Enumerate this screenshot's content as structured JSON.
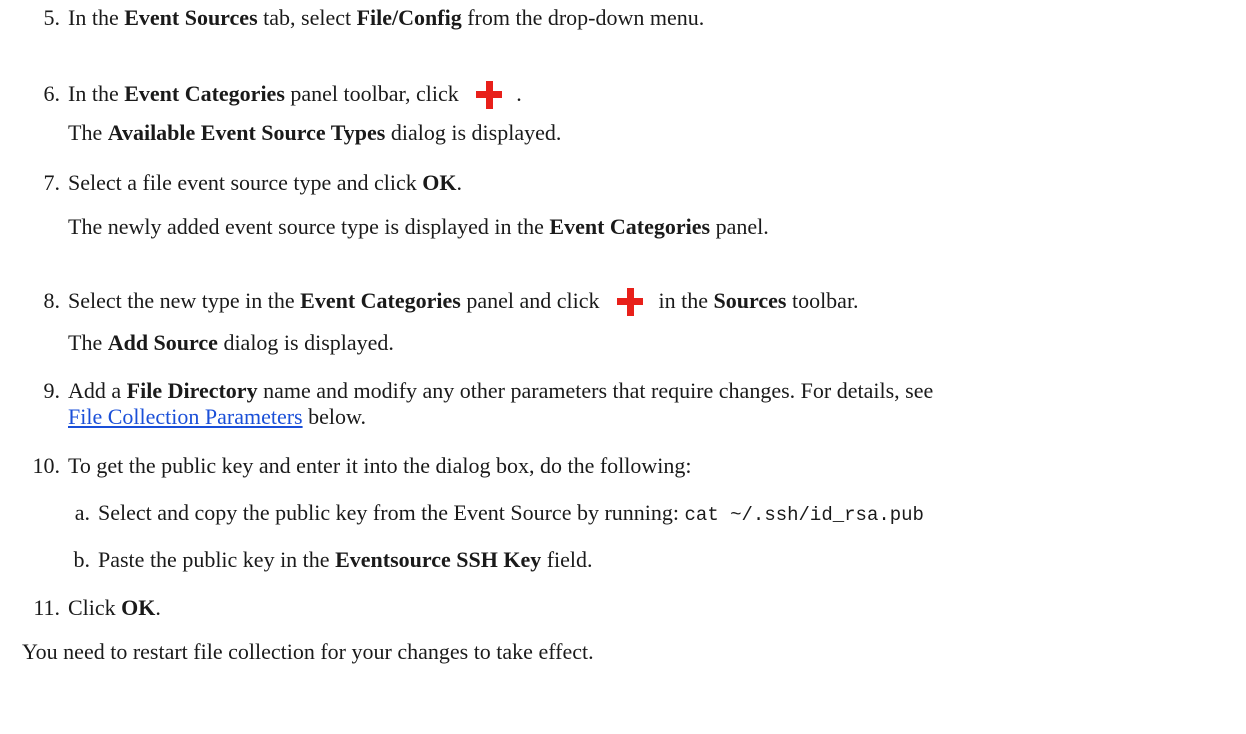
{
  "steps": [
    {
      "number": "5.",
      "text_1": "In the ",
      "bold_1": "Event Sources",
      "text_2": " tab, select ",
      "bold_2": "File/Config",
      "text_3": " from the drop-down menu."
    },
    {
      "number": "6.",
      "text_1": "In the ",
      "bold_1": "Event Categories",
      "text_2": " panel toolbar, click ",
      "icon": "plus-icon",
      "text_3": ".",
      "result_bold": "Available Event Source Types",
      "result_pre": "The ",
      "result_post": " dialog is displayed."
    },
    {
      "number": "7.",
      "text_1": "Select a file event source type and click ",
      "bold_1": "OK",
      "text_2": ".",
      "result_pre": "The newly added event source type is displayed in the ",
      "result_bold": "Event Categories",
      "result_post": " panel."
    },
    {
      "number": "8.",
      "text_1": "Select the new type in the ",
      "bold_1": "Event Categories",
      "text_2": " panel and click ",
      "icon": "plus-icon",
      "text_3": " in the ",
      "bold_2": "Sources",
      "text_4": " toolbar.",
      "result_pre": "The ",
      "result_bold": "Add Source",
      "result_post": " dialog is displayed."
    },
    {
      "number": "9.",
      "text_1": "Add a ",
      "bold_1": "File Directory",
      "text_2": " name and modify any other parameters that require changes. For details, see",
      "link": "File Collection Parameters",
      "text_3": " below."
    },
    {
      "number": "10.",
      "text_1": "To get the public key and enter it into the dialog box, do the following:",
      "substeps": [
        {
          "letter": "a.",
          "text_1": "Select and copy the public key from the Event Source by running: ",
          "code": "cat ~/.ssh/id_rsa.pub"
        },
        {
          "letter": "b.",
          "text_1": "Paste the public key in the ",
          "bold_1": "Eventsource SSH Key",
          "text_2": " field."
        }
      ]
    },
    {
      "number": "11.",
      "text_1": "Click ",
      "bold_1": "OK",
      "text_2": "."
    }
  ],
  "note": "You need to restart file collection for your changes to take effect.",
  "colors": {
    "link": "#1a4fd8",
    "icon": "#e8201a",
    "text": "#1a1a1a"
  }
}
